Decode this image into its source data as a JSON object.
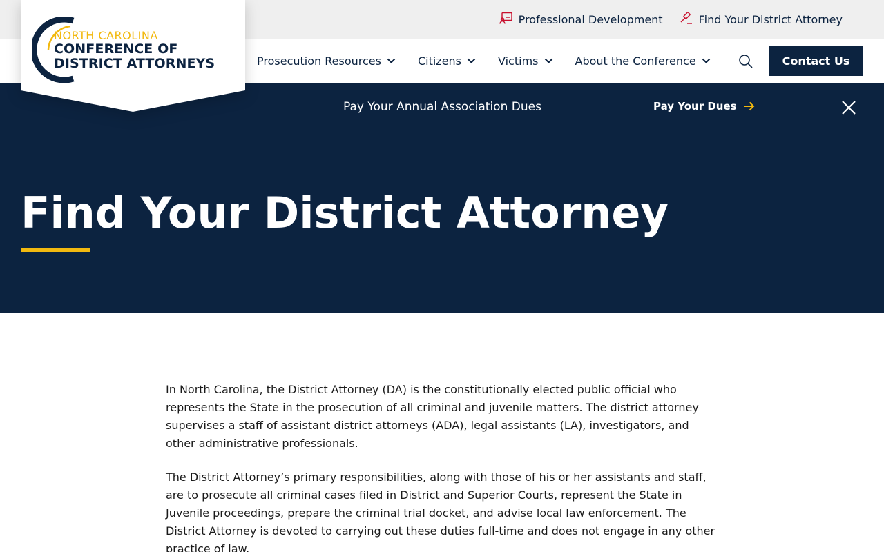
{
  "logo": {
    "line1": "NORTH CAROLINA",
    "line2": "CONFERENCE OF",
    "line3": "DISTRICT ATTORNEYS"
  },
  "utility": {
    "links": [
      {
        "label": "Professional Development",
        "icon": "presentation-icon"
      },
      {
        "label": "Find Your District Attorney",
        "icon": "gavel-icon"
      }
    ]
  },
  "nav": {
    "items": [
      {
        "label": "Prosecution Resources"
      },
      {
        "label": "Citizens"
      },
      {
        "label": "Victims"
      },
      {
        "label": "About the Conference"
      }
    ],
    "search_icon": "search-icon",
    "contact_label": "Contact Us"
  },
  "alert": {
    "text": "Pay Your Annual Association Dues",
    "link_label": "Pay Your Dues"
  },
  "hero": {
    "title": "Find Your District Attorney"
  },
  "content": {
    "paragraphs": [
      "In North Carolina, the District Attorney (DA) is the constitutionally elected public official who represents the State in the prosecution of all criminal and juvenile matters. The district attorney supervises a staff of assistant district attorneys (ADA), legal assistants (LA), investigators, and other administrative professionals.",
      "The District Attorney’s primary responsibilities, along with those of his or her assistants and staff, are to prosecute all criminal cases filed in District and Superior Courts, represent the State in Juvenile proceedings, prepare the criminal trial docket, and advise local law enforcement. The District Attorney is devoted to carrying out these duties full-time and does not engage in any other practice of law."
    ]
  },
  "colors": {
    "navy": "#0c2340",
    "gold": "#f2b90f",
    "icon_red": "#c8102e",
    "utility_bg": "#efefef"
  }
}
